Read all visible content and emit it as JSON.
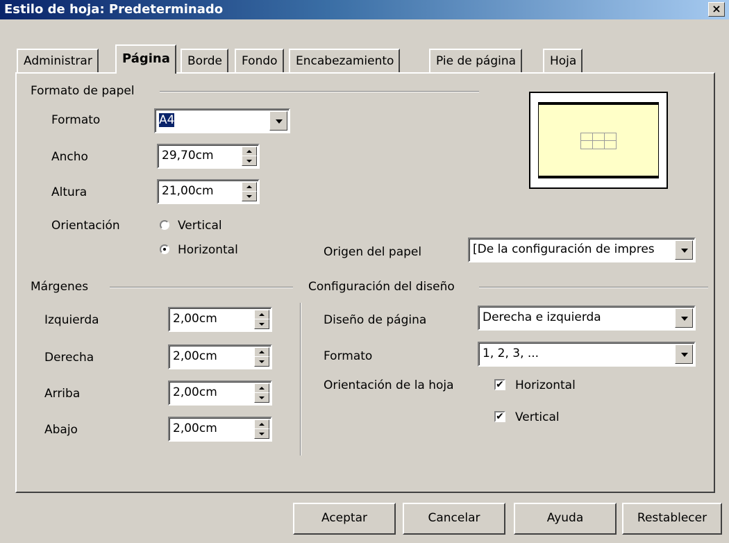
{
  "window": {
    "title": "Estilo de hoja: Predeterminado",
    "close_label": "×"
  },
  "tabs": [
    "Administrar",
    "Página",
    "Borde",
    "Fondo",
    "Encabezamiento",
    "Pie de página",
    "Hoja"
  ],
  "active_tab": "Página",
  "paper_format": {
    "section": "Formato de papel",
    "format_label": "Formato",
    "format_value": "A4",
    "width_label": "Ancho",
    "width_value": "29,70cm",
    "height_label": "Altura",
    "height_value": "21,00cm",
    "orientation_label": "Orientación",
    "orientation_options": [
      "Vertical",
      "Horizontal"
    ],
    "orientation_selected": "Horizontal",
    "paper_tray_label": "Origen del papel",
    "paper_tray_value": "[De la configuración de impres"
  },
  "margins": {
    "section": "Márgenes",
    "left_label": "Izquierda",
    "left_value": "2,00cm",
    "right_label": "Derecha",
    "right_value": "2,00cm",
    "top_label": "Arriba",
    "top_value": "2,00cm",
    "bottom_label": "Abajo",
    "bottom_value": "2,00cm"
  },
  "layout": {
    "section": "Configuración del diseño",
    "page_layout_label": "Diseño de página",
    "page_layout_value": "Derecha e izquierda",
    "format_label": "Formato",
    "format_value": "1, 2, 3, ...",
    "table_alignment_label": "Orientación de la hoja",
    "horizontal_label": "Horizontal",
    "horizontal_checked": true,
    "vertical_label": "Vertical",
    "vertical_checked": true
  },
  "buttons": {
    "ok": "Aceptar",
    "cancel": "Cancelar",
    "help": "Ayuda",
    "reset": "Restablecer"
  },
  "check_glyph": "✔",
  "colors": {
    "title_bar": "#0a246a",
    "dialog_bg": "#d4d0c8",
    "preview_page": "#ffffc8",
    "selection": "#0a246a"
  }
}
